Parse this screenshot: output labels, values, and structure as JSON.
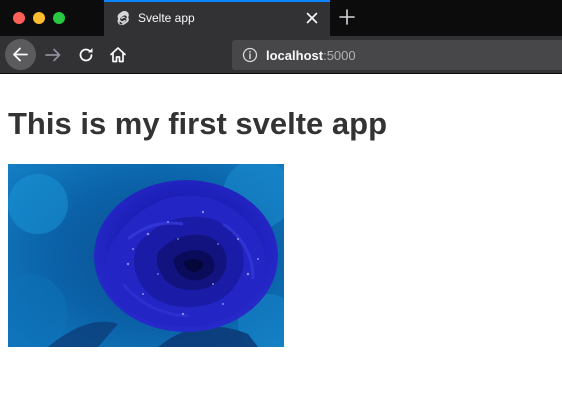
{
  "browser": {
    "tab": {
      "title": "Svelte app",
      "favicon": "svelte-logo-icon"
    },
    "url": {
      "host": "localhost",
      "port": ":5000"
    },
    "colors": {
      "accent": "#0a84ff",
      "toolbar": "#323234",
      "tabstrip": "#0c0c0d"
    }
  },
  "page": {
    "heading": "This is my first svelte app",
    "image": {
      "subject": "blue-rose-image"
    }
  }
}
